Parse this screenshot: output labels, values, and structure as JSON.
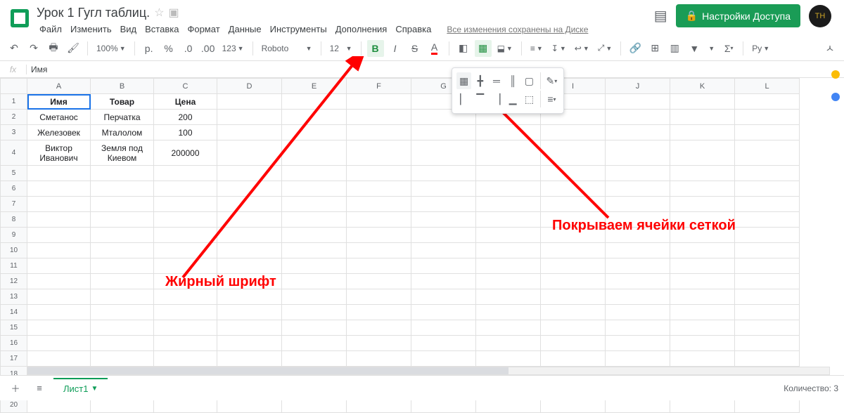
{
  "doc": {
    "title": "Урок 1 Гугл таблиц."
  },
  "menubar": [
    "Файл",
    "Изменить",
    "Вид",
    "Вставка",
    "Формат",
    "Данные",
    "Инструменты",
    "Дополнения",
    "Справка"
  ],
  "saved_text": "Все изменения сохранены на Диске",
  "share_label": "Настройки Доступа",
  "toolbar": {
    "zoom": "100%",
    "currency_label": "р.",
    "percent": "%",
    "dec_dec": ".0",
    "dec_inc": ".00",
    "format_more": "123",
    "font": "Roboto",
    "font_size": "12",
    "script": "Py"
  },
  "fx_value": "Имя",
  "columns": [
    "A",
    "B",
    "C",
    "D",
    "E",
    "F",
    "G",
    "H",
    "I",
    "J",
    "K",
    "L"
  ],
  "rows_shown": 20,
  "table": {
    "headers": {
      "A": "Имя",
      "B": "Товар",
      "C": "Цена"
    },
    "data": [
      {
        "A": "Сметанос",
        "B": "Перчатка",
        "C": "200"
      },
      {
        "A": "Железовек",
        "B": "Мталолом",
        "C": "100"
      },
      {
        "A": "Виктор Иванович",
        "B": "Земля под Киевом",
        "C": "200000"
      }
    ]
  },
  "annotations": {
    "bold": "Жирный шрифт",
    "grid": "Покрываем ячейки сеткой"
  },
  "sheet_tab": "Лист1",
  "footer_count": "Количество: 3"
}
